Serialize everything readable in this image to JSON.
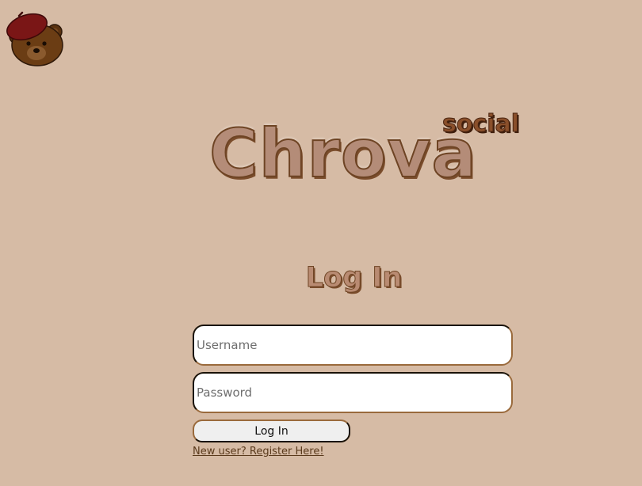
{
  "brand": {
    "name": "Chrova",
    "tagline": "social",
    "mascot_icon": "bear-with-beret-icon"
  },
  "login": {
    "title": "Log In",
    "username_placeholder": "Username",
    "password_placeholder": "Password",
    "submit_label": "Log In",
    "register_link": "New user? Register Here!"
  },
  "colors": {
    "background": "#d6bba5",
    "brand_text": "#b48c78",
    "accent_brown": "#8a4f2a",
    "beret": "#7a1616"
  }
}
